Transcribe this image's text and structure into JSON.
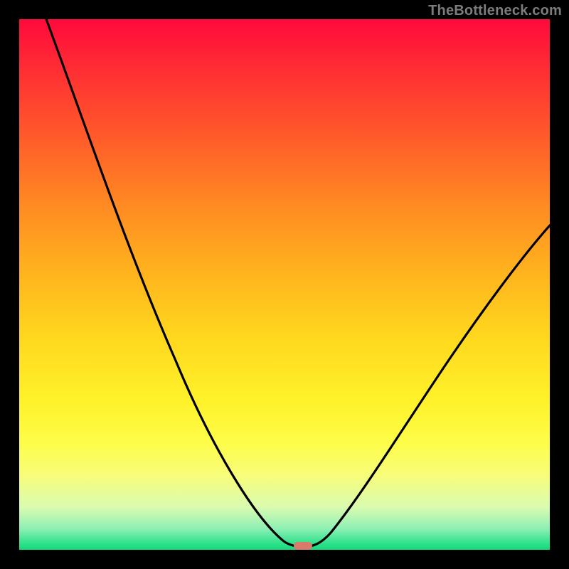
{
  "attribution": "TheBottleneck.com",
  "chart_data": {
    "type": "line",
    "title": "",
    "xlabel": "",
    "ylabel": "",
    "xlim": [
      0,
      100
    ],
    "ylim": [
      0,
      100
    ],
    "x": [
      0,
      5,
      10,
      15,
      20,
      25,
      30,
      35,
      40,
      45,
      48,
      50,
      52,
      54,
      56,
      60,
      65,
      70,
      75,
      80,
      85,
      90,
      95,
      100
    ],
    "values": [
      100,
      90,
      80,
      71,
      62,
      53,
      44,
      35,
      26,
      15,
      7,
      2,
      0,
      0,
      2,
      8,
      17,
      25,
      32,
      39,
      45,
      51,
      56,
      61
    ],
    "marker": {
      "x": 53,
      "y": 0
    },
    "gradient_stops": [
      {
        "pos": 0,
        "color": "#ff0a3c"
      },
      {
        "pos": 50,
        "color": "#ffcc20"
      },
      {
        "pos": 80,
        "color": "#fdfd4a"
      },
      {
        "pos": 100,
        "color": "#17d87c"
      }
    ]
  }
}
